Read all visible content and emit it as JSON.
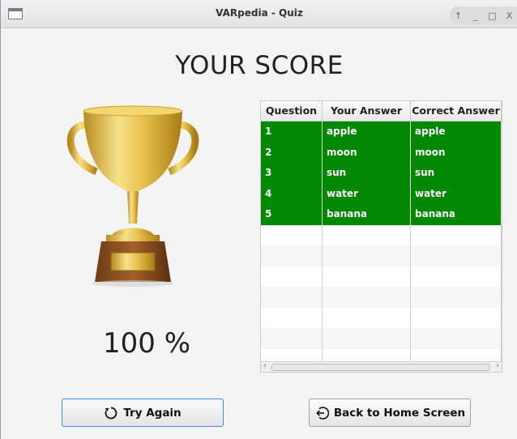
{
  "window": {
    "title": "VARpedia - Quiz",
    "controls": [
      "↑",
      "_",
      "□",
      "X"
    ]
  },
  "heading": "YOUR SCORE",
  "score_text": "100 %",
  "table": {
    "columns": [
      "Question",
      "Your Answer",
      "Correct Answer"
    ],
    "rows": [
      [
        "1",
        "apple",
        "apple"
      ],
      [
        "2",
        "moon",
        "moon"
      ],
      [
        "3",
        "sun",
        "sun"
      ],
      [
        "4",
        "water",
        "water"
      ],
      [
        "5",
        "banana",
        "banana"
      ]
    ],
    "correct_row_color": "#028802"
  },
  "buttons": {
    "try_again": {
      "label": "Try Again",
      "icon": "refresh-icon"
    },
    "home": {
      "label": "Back to Home Screen",
      "icon": "back-arrow-icon"
    }
  },
  "trophy": {
    "icon": "trophy-icon"
  }
}
